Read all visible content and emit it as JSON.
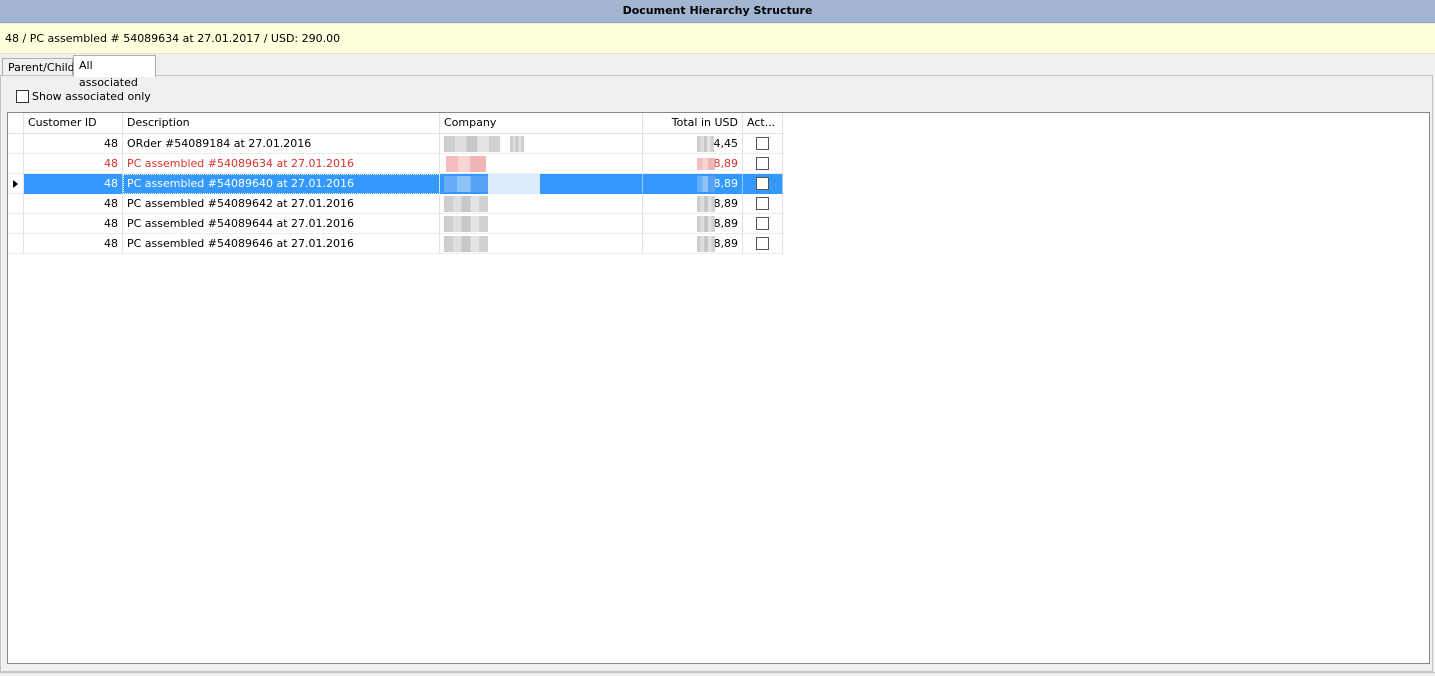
{
  "window": {
    "title": "Document Hierarchy Structure"
  },
  "info_bar": {
    "text": "48 /  PC assembled # 54089634 at 27.01.2017 / USD: 290.00"
  },
  "tabs": [
    {
      "label": "Parent/Child",
      "active": false
    },
    {
      "label": "All associated",
      "active": true
    }
  ],
  "filter": {
    "show_associated_only_label": "Show associated only",
    "checked": false
  },
  "grid": {
    "columns": [
      "Customer ID",
      "Description",
      "Company",
      "Total in USD",
      "Act..."
    ],
    "rows": [
      {
        "customer_id": "48",
        "description": "ORder #54089184 at 27.01.2016",
        "total": "4,45",
        "style": "normal",
        "selected": false,
        "active": false
      },
      {
        "customer_id": "48",
        "description": "PC assembled #54089634 at 27.01.2016",
        "total": "8,89",
        "style": "red",
        "selected": false,
        "active": false
      },
      {
        "customer_id": "48",
        "description": "PC assembled #54089640 at 27.01.2016",
        "total": "8,89",
        "style": "normal",
        "selected": true,
        "active": false
      },
      {
        "customer_id": "48",
        "description": "PC assembled #54089642 at 27.01.2016",
        "total": "8,89",
        "style": "normal",
        "selected": false,
        "active": false
      },
      {
        "customer_id": "48",
        "description": "PC assembled #54089644 at 27.01.2016",
        "total": "8,89",
        "style": "normal",
        "selected": false,
        "active": false
      },
      {
        "customer_id": "48",
        "description": "PC assembled #54089646 at 27.01.2016",
        "total": "8,89",
        "style": "normal",
        "selected": false,
        "active": false
      }
    ]
  },
  "colors": {
    "title_bar": "#a3b6d1",
    "info_bar": "#ffffdd",
    "selection": "#3399ff",
    "highlight_text": "#d9322c"
  }
}
